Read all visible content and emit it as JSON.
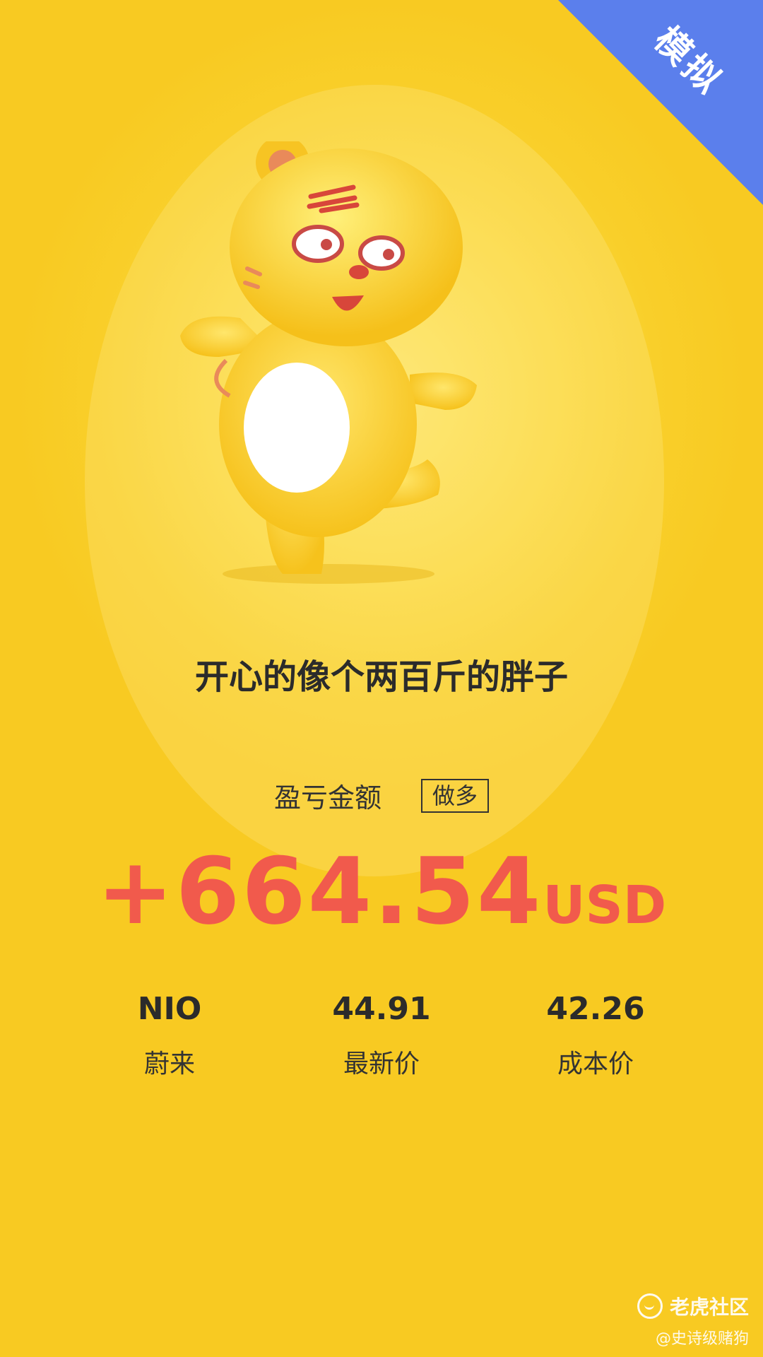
{
  "corner": {
    "label": "模拟",
    "color": "#5b7fec"
  },
  "mascot": {
    "name": "tiger-mascot-icon"
  },
  "slogan": "开心的像个两百斤的胖子",
  "profit": {
    "label": "盈亏金额",
    "direction_tag": "做多",
    "value": "+664.54",
    "unit": "USD",
    "color": "#f15a4c"
  },
  "stats": [
    {
      "value": "NIO",
      "label": "蔚来"
    },
    {
      "value": "44.91",
      "label": "最新价"
    },
    {
      "value": "42.26",
      "label": "成本价"
    }
  ],
  "watermark": {
    "brand": "老虎社区",
    "user": "@史诗级赌狗"
  },
  "colors": {
    "background": "#f9cf2a",
    "text": "#2b2b2b"
  }
}
